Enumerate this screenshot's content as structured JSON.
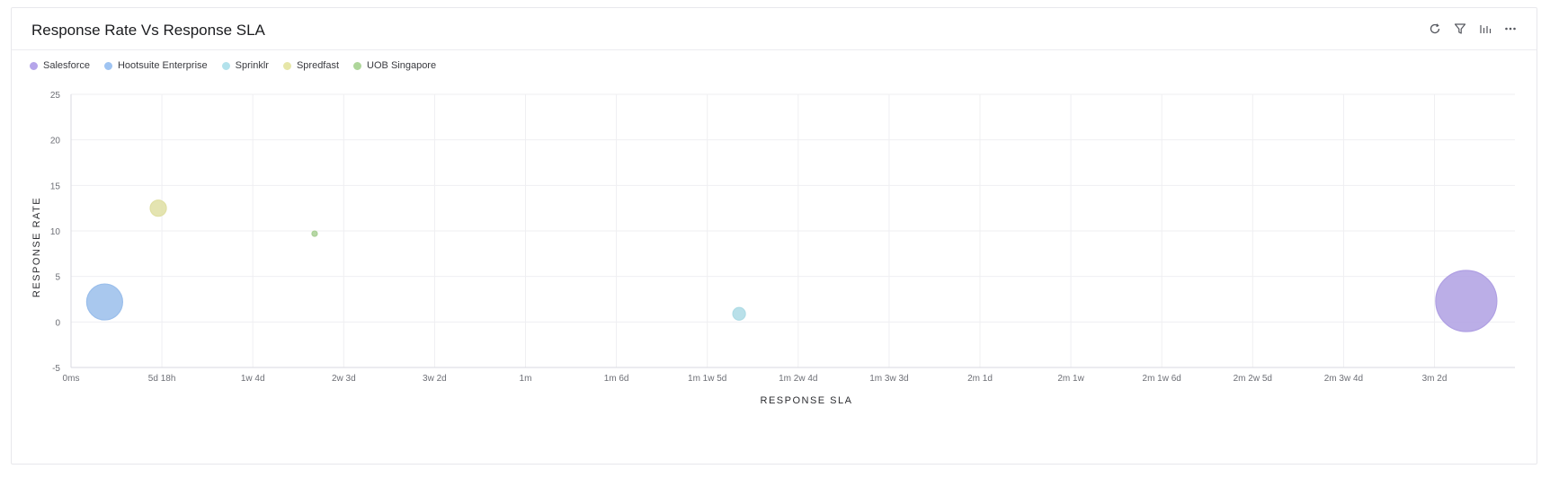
{
  "widget": {
    "title": "Response Rate Vs Response SLA"
  },
  "toolbar": {
    "icons": [
      "refresh-icon",
      "filter-icon",
      "bar-chart-icon",
      "more-icon"
    ]
  },
  "chart_data": {
    "type": "scatter",
    "subtype": "bubble",
    "title": "Response Rate Vs Response SLA",
    "xlabel": "RESPONSE SLA",
    "ylabel": "RESPONSE RATE",
    "x_ticks": [
      "0ms",
      "5d 18h",
      "1w 4d",
      "2w 3d",
      "3w 2d",
      "1m",
      "1m 6d",
      "1m 1w 5d",
      "1m 2w 4d",
      "1m 3w 3d",
      "2m 1d",
      "2m 1w",
      "2m 1w 6d",
      "2m 2w 5d",
      "2m 3w 4d",
      "3m 2d"
    ],
    "y_ticks": [
      25,
      20,
      15,
      10,
      5,
      0,
      -5
    ],
    "ylim": [
      -5,
      25
    ],
    "grid": true,
    "legend_position": "top-left",
    "series": [
      {
        "name": "Salesforce",
        "color": "#b5a5ea",
        "points": [
          {
            "x_index": 15.35,
            "y": 2.3,
            "size": 34
          }
        ]
      },
      {
        "name": "Hootsuite Enterprise",
        "color": "#9fc4f2",
        "points": [
          {
            "x_index": 0.37,
            "y": 2.2,
            "size": 20
          }
        ]
      },
      {
        "name": "Sprinklr",
        "color": "#b3e2ec",
        "points": [
          {
            "x_index": 7.35,
            "y": 0.9,
            "size": 7
          }
        ]
      },
      {
        "name": "Spredfast",
        "color": "#e6e6a8",
        "points": [
          {
            "x_index": 0.96,
            "y": 12.5,
            "size": 9
          }
        ]
      },
      {
        "name": "UOB Singapore",
        "color": "#aed69a",
        "points": [
          {
            "x_index": 2.68,
            "y": 9.7,
            "size": 3
          }
        ]
      }
    ]
  }
}
